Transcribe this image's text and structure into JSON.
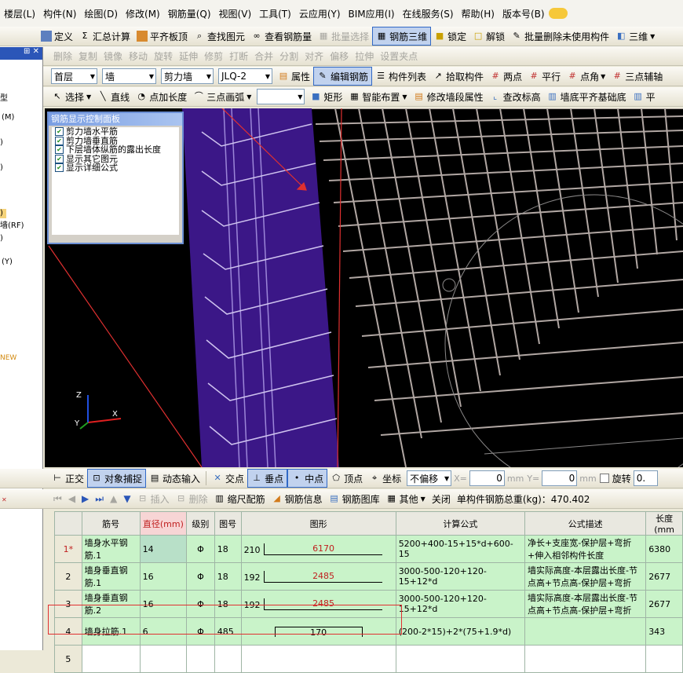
{
  "menu": [
    "楼层(L)",
    "构件(N)",
    "绘图(D)",
    "修改(M)",
    "钢筋量(Q)",
    "视图(V)",
    "工具(T)",
    "云应用(Y)",
    "BIM应用(I)",
    "在线服务(S)",
    "帮助(H)",
    "版本号(B)"
  ],
  "toolbar1": {
    "define": "定义",
    "sum": "汇总计算",
    "flat": "平齐板顶",
    "find": "查找图元",
    "view_rebar": "查看钢筋量",
    "batch": "批量选择",
    "rebar3d": "钢筋三维",
    "lock": "锁定",
    "unlock": "解锁",
    "batchdel": "批量删除未使用构件",
    "threed": "三维"
  },
  "toolbar2": [
    "删除",
    "复制",
    "镜像",
    "移动",
    "旋转",
    "延伸",
    "修剪",
    "打断",
    "合并",
    "分割",
    "对齐",
    "偏移",
    "拉伸",
    "设置夹点"
  ],
  "toolbar3": {
    "floor": "首层",
    "type": "墙",
    "sub": "剪力墙",
    "id": "JLQ-2",
    "prop": "属性",
    "edit": "编辑钢筋",
    "list": "构件列表",
    "pick": "拾取构件",
    "twopt": "两点",
    "parallel": "平行",
    "angle": "点角",
    "axis": "三点辅轴"
  },
  "toolbar4": {
    "select": "选择",
    "line": "直线",
    "ptlen": "点加长度",
    "arc": "三点画弧",
    "rect": "矩形",
    "smart": "智能布置",
    "modify": "修改墙段属性",
    "check": "查改标高",
    "align": "墙底平齐基础底",
    "flat": "平"
  },
  "left": [
    "型",
    "(M)",
    ")",
    ")",
    ")",
    "墙(RF)",
    ")",
    "(Y)",
    "NEW"
  ],
  "ctrl_panel": {
    "title": "钢筋显示控制面板",
    "items": [
      "剪力墙水平筋",
      "剪力墙垂直筋",
      "下层墙体纵筋的露出长度",
      "显示其它图元",
      "显示详细公式"
    ]
  },
  "bottombar": {
    "ortho": "正交",
    "snap": "对象捕捉",
    "dyn": "动态输入",
    "cross": "交点",
    "perp": "垂点",
    "mid": "中点",
    "vertex": "顶点",
    "coord": "坐标",
    "offset": "不偏移",
    "x_label": "X=",
    "x_val": "0",
    "y_label": "Y=",
    "y_val": "0",
    "unit": "mm",
    "rotate": "旋转",
    "rotate_val": "0."
  },
  "rebarbar": {
    "insert": "插入",
    "delete": "删除",
    "scale": "缩尺配筋",
    "info": "钢筋信息",
    "lib": "钢筋图库",
    "other": "其他",
    "close": "关闭",
    "total": "单构件钢筋总重(kg)：470.402"
  },
  "table": {
    "headers": [
      "筋号",
      "直径(mm)",
      "级别",
      "图号",
      "图形",
      "计算公式",
      "公式描述",
      "长度(mm"
    ],
    "rows": [
      {
        "n": "1*",
        "name": "墙身水平钢筋.1",
        "dia": "14",
        "grade": "Φ",
        "fig": "18",
        "pre": "210",
        "shape": "6170",
        "formula": "5200+400-15+15*d+600-15",
        "desc": "净长+支座宽-保护层+弯折+伸入相邻构件长度",
        "len": "6380"
      },
      {
        "n": "2",
        "name": "墙身垂直钢筋.1",
        "dia": "16",
        "grade": "Φ",
        "fig": "18",
        "pre": "192",
        "shape": "2485",
        "formula": "3000-500-120+120-15+12*d",
        "desc": "墙实际高度-本层露出长度-节点高+节点高-保护层+弯折",
        "len": "2677"
      },
      {
        "n": "3",
        "name": "墙身垂直钢筋.2",
        "dia": "16",
        "grade": "Φ",
        "fig": "18",
        "pre": "192",
        "shape": "2485",
        "formula": "3000-500-120+120-15+12*d",
        "desc": "墙实际高度-本层露出长度-节点高+节点高-保护层+弯折",
        "len": "2677"
      },
      {
        "n": "4",
        "name": "墙身拉筋.1",
        "dia": "6",
        "grade": "Φ",
        "fig": "485",
        "pre": "",
        "shape": "170",
        "formula": "(200-2*15)+2*(75+1.9*d)",
        "desc": "",
        "len": "343"
      },
      {
        "n": "5",
        "name": "",
        "dia": "",
        "grade": "",
        "fig": "",
        "pre": "",
        "shape": "",
        "formula": "",
        "desc": "",
        "len": ""
      }
    ]
  }
}
